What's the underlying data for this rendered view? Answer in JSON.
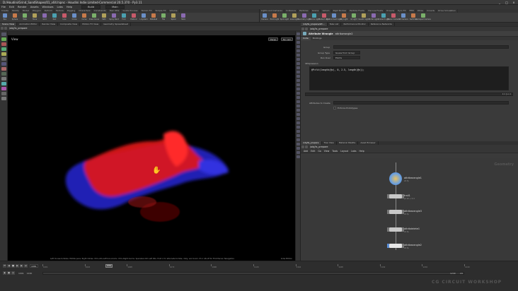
{
  "window": {
    "title": "D:/Houdini/Grind_SandShapes/01_v04.hipnc - Houdini Indie Limited-Commercial 20.5.370 - Py3.11",
    "controls": [
      "_",
      "□",
      "×"
    ]
  },
  "menubar": [
    "File",
    "Edit",
    "Render",
    "Assets",
    "Windows",
    "Labs",
    "Help"
  ],
  "desktop": {
    "left": "Build",
    "right": "Main"
  },
  "shelf_left": {
    "tabs": [
      "Create",
      "Modify",
      "Model",
      "Polygon",
      "Deform",
      "Texture",
      "Rigging",
      "Characters",
      "Constraints",
      "Hair Utils",
      "Guide Process",
      "Terrain FX",
      "Simple FX",
      "Volume"
    ],
    "tools": [
      "Box",
      "Sphere",
      "Tube",
      "Torus",
      "Grid",
      "Null",
      "Line",
      "Circle",
      "Curve",
      "Draw Curve",
      "Path",
      "Spray Paint",
      "Font",
      "Platonic",
      "L-System",
      "Metaball",
      "File",
      "Spiral",
      "Helix"
    ]
  },
  "shelf_right": {
    "tabs": [
      "Lights and Cameras",
      "Collisions",
      "Particles",
      "Grains",
      "Vellum",
      "Rigid Bodies",
      "Particle Fluids",
      "Viscous Fluids",
      "Oceans",
      "Pyro FX",
      "FEM",
      "Wires",
      "Crowds",
      "Drive Simulation"
    ],
    "tools": [
      "Camera",
      "Point Light",
      "Spot Light",
      "Area Light",
      "Geometry Light",
      "Volume Light",
      "Distant Light",
      "Environment Light",
      "Sky Light",
      "GI Light",
      "Caustic Light",
      "Portal Light",
      "Ambient Light",
      "Stereo Camera",
      "VR Camera",
      "Switcher",
      "Gamepad Camera"
    ]
  },
  "viewer_tabs": [
    "Scene View",
    "Animation Editor",
    "Render View",
    "Composite View",
    "Motion FX View",
    "Geometry Spreadsheet"
  ],
  "viewer_path": "/obj/ts_prepare",
  "viewport": {
    "label": "View",
    "persp_button": "Persp",
    "cam_button": "No cam",
    "status": "Left mouse tumbles. Middle pans. Right dollies. Ctrl+Alt+Left box-zooms. Ctrl+Right zooms. Spacebar-Ctrl-Left tilts. Hold L for alternate tumble, dolly, and zoom. M or Alt+M for First Person Navigation.",
    "cam_status": "Indie Edition"
  },
  "param_tabs": [
    "/obj/ts_prepare/att...",
    "Take List",
    "Performance Monitor",
    "Reference Networks"
  ],
  "param_path": "/obj/ts_prepare",
  "node_header": {
    "type": "Attribute Wrangle",
    "name": "attribwrangle2"
  },
  "param_subtabs": [
    "Code",
    "Bindings"
  ],
  "params": {
    "group_label": "Group",
    "group_type_label": "Group Type",
    "group_type_value": "Guess from Group",
    "run_over_label": "Run Over",
    "run_over_value": "Points",
    "vexpression_label": "VEXpression",
    "code": "@P=fit(length(@v), 0, 2.5, length(@v));",
    "line_info": "1:1 | Ln 1",
    "attrs_create_label": "Attributes to Create",
    "enable_perf_label": "Enforce Prototypes"
  },
  "network_tabs": [
    "/obj/ts_prepare",
    "Tree View",
    "Material Palette",
    "Asset Browser"
  ],
  "network_path": "/obj/ts_prepare",
  "network_menu": [
    "Add",
    "Edit",
    "Go",
    "View",
    "Tools",
    "Layout",
    "Labs",
    "Help"
  ],
  "network_context": "Geometry",
  "nodes": [
    {
      "name": "attribwrangle1",
      "sub": "21 fp"
    },
    {
      "name": "trail1",
      "sub": "pt 10 + 0.4"
    },
    {
      "name": "attribwrangle3",
      "sub": "21 fp"
    },
    {
      "name": "attribdelete1",
      "sub": "21 fp"
    },
    {
      "name": "attribwrangle2",
      "sub": "21 fp"
    }
  ],
  "timeline": {
    "frame": "1061",
    "start": "1001",
    "end": "1240",
    "ticks": [
      "1001",
      "1024",
      "1048",
      "1072",
      "1096",
      "1120",
      "1144",
      "1168",
      "1192",
      "1216",
      "1240"
    ],
    "current_marker": "1061",
    "range_start": "1001",
    "range_end": "1240",
    "fps_label": "24"
  },
  "watermark": "CG CIRCUIT WORKSHOP",
  "colors": {
    "accent": "#5b8fd6",
    "viewport_bg": "#000000",
    "red_points": "#ff1e1e",
    "blue_points": "#2a2ad8"
  }
}
